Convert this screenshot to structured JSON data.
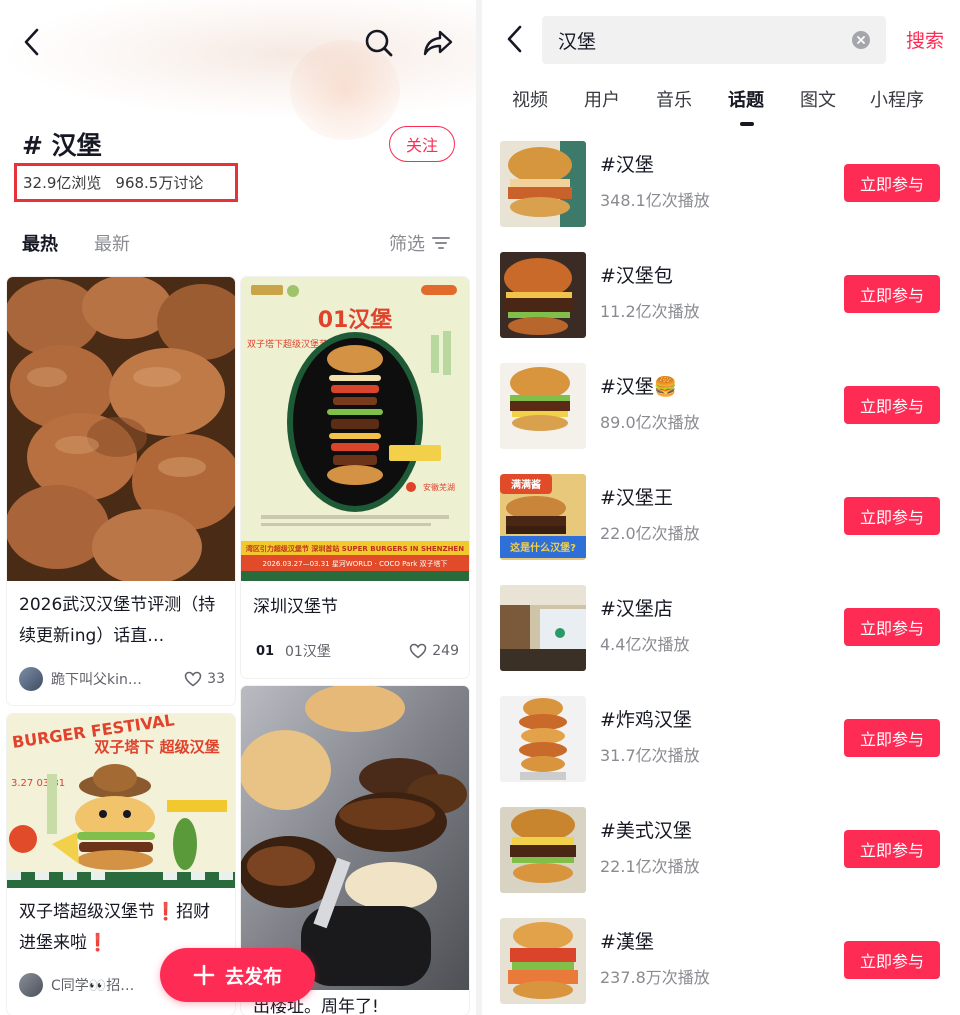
{
  "left": {
    "topic_title": "# 汉堡",
    "follow_label": "关注",
    "stats": {
      "views": "32.9亿浏览",
      "discussions": "968.5万讨论"
    },
    "sort": {
      "hot": "最热",
      "new": "最新",
      "filter": "筛选"
    },
    "posts": [
      {
        "title": "2026武汉汉堡节评测（持续更新ing）话直…",
        "author": "跪下叫父kin…",
        "likes": "33"
      },
      {
        "title": "深圳汉堡节",
        "author": "01汉堡",
        "likes": "249",
        "poster": {
          "brand": "01汉堡",
          "side_title": "双子塔下超级汉堡节",
          "banner": "湾区引力超级汉堡节 深圳首站 SUPER BURGERS IN SHENZHEN",
          "dates": "2026.03.27—03.31 星河WORLD · COCO Park 双子塔下",
          "tag": "安徽芜湖"
        }
      },
      {
        "title": "双子塔超级汉堡节❗招财进堡来啦❗",
        "author": "C同学👀招…",
        "poster": {
          "headline": "双子塔下 超级汉堡",
          "festival": "BURGER FESTIVAL",
          "dates": "3.27 03.31"
        }
      },
      {
        "title": "出楼址。周年了!"
      }
    ],
    "publish_label": "去发布"
  },
  "right": {
    "search_query": "汉堡",
    "search_button": "搜索",
    "tabs": [
      "视频",
      "用户",
      "音乐",
      "话题",
      "图文",
      "小程序"
    ],
    "active_tab": "话题",
    "join_label": "立即参与",
    "topics": [
      {
        "name": "#汉堡",
        "plays": "348.1亿次播放"
      },
      {
        "name": "#汉堡包",
        "plays": "11.2亿次播放"
      },
      {
        "name": "#汉堡🍔",
        "plays": "89.0亿次播放"
      },
      {
        "name": "#汉堡王",
        "plays": "22.0亿次播放",
        "overlay_top": "满满酱",
        "overlay_bottom": "这是什么汉堡?"
      },
      {
        "name": "#汉堡店",
        "plays": "4.4亿次播放"
      },
      {
        "name": "#炸鸡汉堡",
        "plays": "31.7亿次播放"
      },
      {
        "name": "#美式汉堡",
        "plays": "22.1亿次播放"
      },
      {
        "name": "#漢堡",
        "plays": "237.8万次播放"
      }
    ]
  },
  "colors": {
    "accent": "#fe2c55",
    "highlight_box": "#e8323a",
    "text_primary": "#161823",
    "text_secondary": "#8a8b91"
  }
}
